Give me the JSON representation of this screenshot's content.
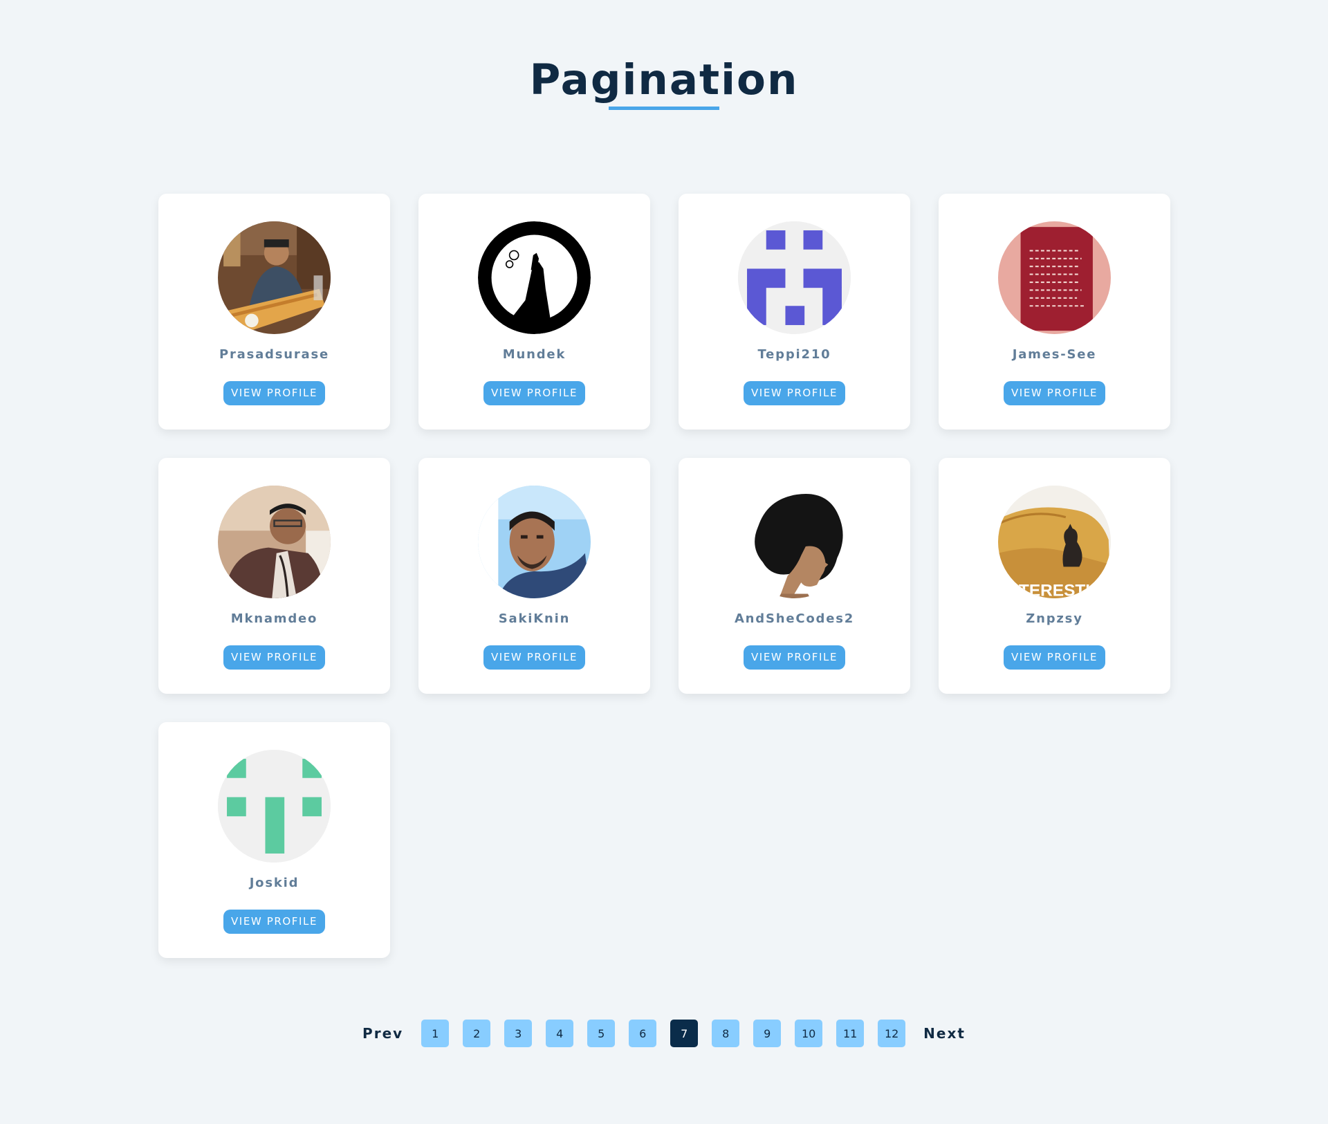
{
  "page": {
    "title": "Pagination"
  },
  "users": [
    {
      "name": "Prasadsurase",
      "button": "VIEW PROFILE",
      "avatar": "photo-man-with-dosa"
    },
    {
      "name": "Mundek",
      "button": "VIEW PROFILE",
      "avatar": "bird-on-rock-logo"
    },
    {
      "name": "Teppi210",
      "button": "VIEW PROFILE",
      "avatar": "identicon-purple"
    },
    {
      "name": "James-See",
      "button": "VIEW PROFILE",
      "avatar": "red-handwritten-note"
    },
    {
      "name": "Mknamdeo",
      "button": "VIEW PROFILE",
      "avatar": "photo-man-suit"
    },
    {
      "name": "SakiKnin",
      "button": "VIEW PROFILE",
      "avatar": "photo-man-selfie"
    },
    {
      "name": "AndSheCodes2",
      "button": "VIEW PROFILE",
      "avatar": "woman-silhouette-illustration"
    },
    {
      "name": "Znpzsy",
      "button": "VIEW PROFILE",
      "avatar": "cat-on-sofa"
    },
    {
      "name": "Joskid",
      "button": "VIEW PROFILE",
      "avatar": "identicon-green"
    }
  ],
  "avatar_texts": {
    "znpzsy_overlay": "TERESTI"
  },
  "pagination": {
    "prev": "Prev",
    "next": "Next",
    "pages": [
      "1",
      "2",
      "3",
      "4",
      "5",
      "6",
      "7",
      "8",
      "9",
      "10",
      "11",
      "12"
    ],
    "current": "7"
  },
  "colors": {
    "background": "#f1f5f8",
    "title": "#102a43",
    "accent": "#49a6e9",
    "name_text": "#617d98",
    "page_button": "#88cdff",
    "page_button_active": "#0a2c4a",
    "identicon_purple": "#5b58d4",
    "identicon_green": "#5ccba0"
  }
}
